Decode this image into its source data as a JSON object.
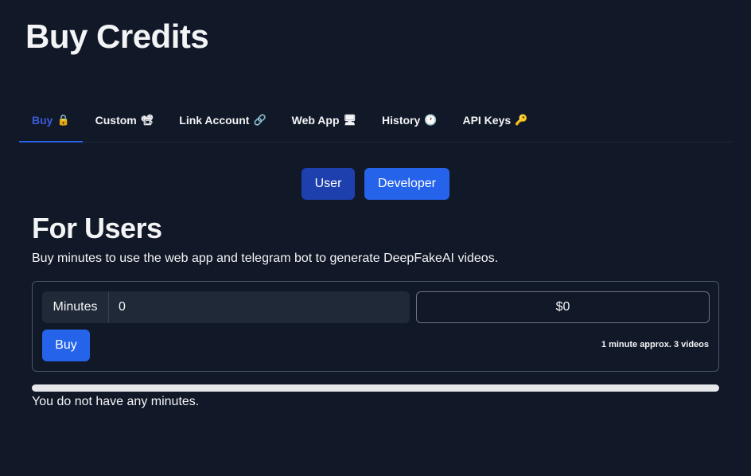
{
  "page": {
    "title": "Buy Credits"
  },
  "tabs": [
    {
      "label": "Buy",
      "icon": "🔒",
      "icon_name": "lock-icon",
      "active": true
    },
    {
      "label": "Custom",
      "icon": "📽",
      "icon_name": "film-projector-icon",
      "active": false
    },
    {
      "label": "Link Account",
      "icon": "🔗",
      "icon_name": "link-icon",
      "active": false
    },
    {
      "label": "Web App",
      "icon": "🖥",
      "icon_name": "desktop-computer-icon",
      "active": false
    },
    {
      "label": "History",
      "icon": "🕐",
      "icon_name": "clock-icon",
      "active": false
    },
    {
      "label": "API Keys",
      "icon": "🔑",
      "icon_name": "key-icon",
      "active": false
    }
  ],
  "mode_toggle": {
    "user_label": "User",
    "developer_label": "Developer"
  },
  "section": {
    "title": "For Users",
    "description": "Buy minutes to use the web app and telegram bot to generate DeepFakeAI videos."
  },
  "purchase": {
    "minutes_label": "Minutes",
    "minutes_value": "0",
    "price": "$0",
    "buy_label": "Buy",
    "note": "1 minute approx. 3 videos"
  },
  "balance": {
    "progress": 0,
    "status": "You do not have any minutes."
  },
  "colors": {
    "background": "#111827",
    "accent": "#2563eb",
    "user_button": "#1e40af",
    "active_tab": "#3b5bdb"
  }
}
